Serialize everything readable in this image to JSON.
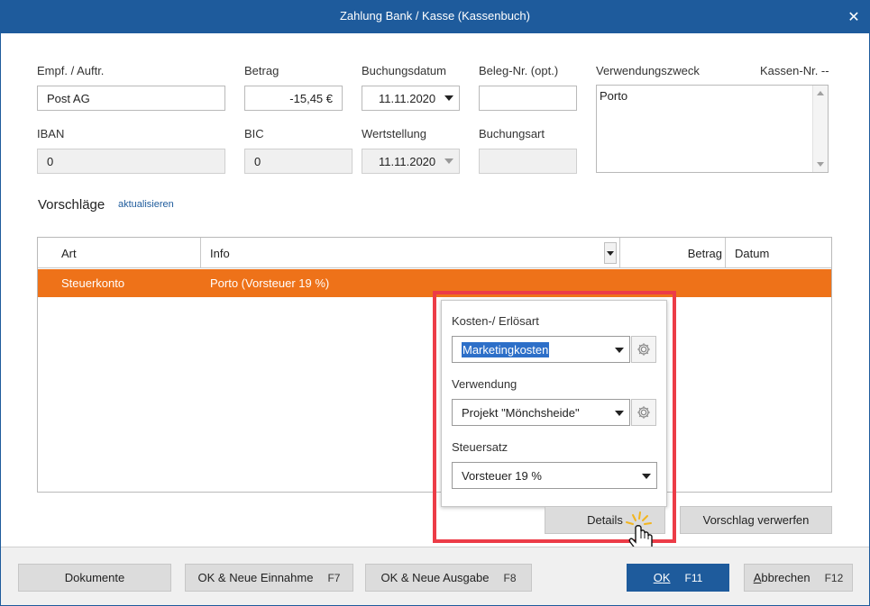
{
  "window": {
    "title": "Zahlung Bank / Kasse (Kassenbuch)",
    "close_glyph": "✕"
  },
  "form": {
    "empf_label": "Empf. / Auftr.",
    "empf_value": "Post AG",
    "betrag_label": "Betrag",
    "betrag_value": "-15,45 €",
    "buchungsdatum_label": "Buchungsdatum",
    "buchungsdatum_value": "11.11.2020",
    "beleg_label": "Beleg-Nr. (opt.)",
    "beleg_value": "",
    "verwendungszweck_label": "Verwendungszweck",
    "verwendungszweck_value": "Porto",
    "kassen_label": "Kassen-Nr. --",
    "iban_label": "IBAN",
    "iban_value": "0",
    "bic_label": "BIC",
    "bic_value": "0",
    "wertstellung_label": "Wertstellung",
    "wertstellung_value": "11.11.2020",
    "buchungsart_label": "Buchungsart",
    "buchungsart_value": ""
  },
  "vorschlaege": {
    "title": "Vorschläge",
    "refresh_link": "aktualisieren",
    "columns": [
      "Art",
      "Info",
      "Betrag",
      "Datum"
    ],
    "rows": [
      {
        "art": "Steuerkonto",
        "info": "Porto (Vorsteuer 19 %)",
        "betrag": "",
        "datum": ""
      }
    ]
  },
  "details_popup": {
    "kosten_label": "Kosten-/ Erlösart",
    "kosten_value": "Marketingkosten",
    "verwendung_label": "Verwendung",
    "verwendung_value": "Projekt \"Mönchsheide\"",
    "steuersatz_label": "Steuersatz",
    "steuersatz_value": "Vorsteuer 19 %"
  },
  "actions": {
    "details": "Details",
    "verwerfen": "Vorschlag verwerfen"
  },
  "footer": {
    "dokumente": "Dokumente",
    "neue_einnahme": "OK & Neue Einnahme",
    "neue_einnahme_key": "F7",
    "neue_ausgabe": "OK & Neue Ausgabe",
    "neue_ausgabe_key": "F8",
    "ok_u": "O",
    "ok_rest": "K",
    "ok_key": "F11",
    "abbrechen_u": "A",
    "abbrechen_rest": "bbrechen",
    "abbrechen_key": "F12"
  },
  "colors": {
    "title_bar": "#1e5b9c",
    "selected_row": "#ee7219",
    "highlight_box": "#ec3c47",
    "primary_button": "#1e5b9c"
  },
  "icons": {
    "close": "close-icon",
    "gear": "gear-icon",
    "cursor": "hand-pointer-icon",
    "dropdown": "chevron-down-icon"
  }
}
